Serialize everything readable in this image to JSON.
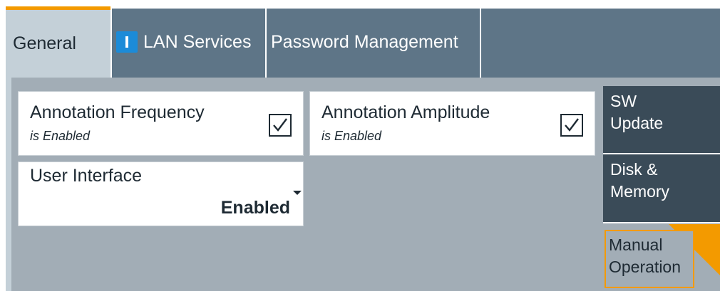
{
  "tabs": [
    {
      "label": "General",
      "active": true
    },
    {
      "label": "LAN Services",
      "icon": "lan-info-icon"
    },
    {
      "label": "Password Management"
    }
  ],
  "settings": {
    "annotation_frequency": {
      "title": "Annotation Frequency",
      "status": "is Enabled",
      "checked": true
    },
    "annotation_amplitude": {
      "title": "Annotation Amplitude",
      "status": "is Enabled",
      "checked": true
    },
    "user_interface": {
      "title": "User Interface",
      "value": "Enabled"
    }
  },
  "side_buttons": [
    {
      "label_line1": "SW",
      "label_line2": "Update"
    },
    {
      "label_line1": "Disk &",
      "label_line2": "Memory"
    },
    {
      "label_line1": "Manual",
      "label_line2": "Operation",
      "selected": true
    }
  ],
  "colors": {
    "accent": "#f39a00",
    "tab_bar": "#5e7587",
    "active_tab": "#c4d0d8",
    "content_bg": "#a2adb6",
    "side_button": "#3a4b58",
    "lan_icon": "#1c8bd8"
  }
}
